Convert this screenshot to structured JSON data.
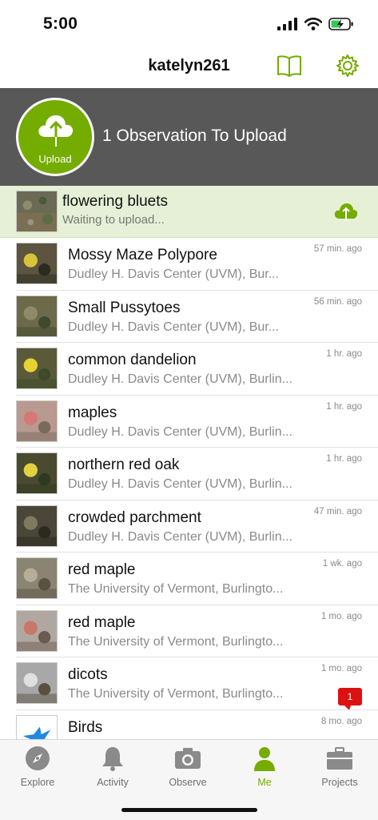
{
  "status": {
    "time": "5:00"
  },
  "header": {
    "title": "katelyn261",
    "book_icon": "guide-book-icon",
    "settings_icon": "gear-icon"
  },
  "colors": {
    "accent": "#74ac00",
    "banner": "#585858",
    "pending_bg": "#e6f0d6",
    "badge": "#dd1111"
  },
  "upload": {
    "button_label": "Upload",
    "message": "1 Observation To Upload"
  },
  "pending": {
    "title": "flowering bluets",
    "status": "Waiting to upload..."
  },
  "observations": [
    {
      "title": "Mossy Maze Polypore",
      "location": "Dudley H. Davis Center (UVM), Bur...",
      "time": "57 min. ago"
    },
    {
      "title": "Small Pussytoes",
      "location": "Dudley H. Davis Center (UVM), Bur...",
      "time": "56 min. ago"
    },
    {
      "title": "common dandelion",
      "location": "Dudley H. Davis Center (UVM), Burlin...",
      "time": "1 hr. ago"
    },
    {
      "title": "maples",
      "location": "Dudley H. Davis Center (UVM), Burlin...",
      "time": "1 hr. ago"
    },
    {
      "title": "northern red oak",
      "location": "Dudley H. Davis Center (UVM), Burlin...",
      "time": "1 hr. ago"
    },
    {
      "title": "crowded parchment",
      "location": "Dudley H. Davis Center (UVM), Burlin...",
      "time": "47 min. ago"
    },
    {
      "title": "red maple",
      "location": "The University of Vermont, Burlingto...",
      "time": "1 wk. ago"
    },
    {
      "title": "red maple",
      "location": "The University of Vermont, Burlingto...",
      "time": "1 mo. ago"
    },
    {
      "title": "dicots",
      "location": "The University of Vermont, Burlingto...",
      "time": "1 mo. ago",
      "comments": "1"
    },
    {
      "title": "Birds",
      "location": "",
      "time": "8 mo. ago"
    }
  ],
  "tabs": [
    {
      "label": "Explore",
      "icon": "compass-icon"
    },
    {
      "label": "Activity",
      "icon": "bell-icon"
    },
    {
      "label": "Observe",
      "icon": "camera-icon"
    },
    {
      "label": "Me",
      "icon": "person-icon",
      "active": true
    },
    {
      "label": "Projects",
      "icon": "briefcase-icon"
    }
  ]
}
